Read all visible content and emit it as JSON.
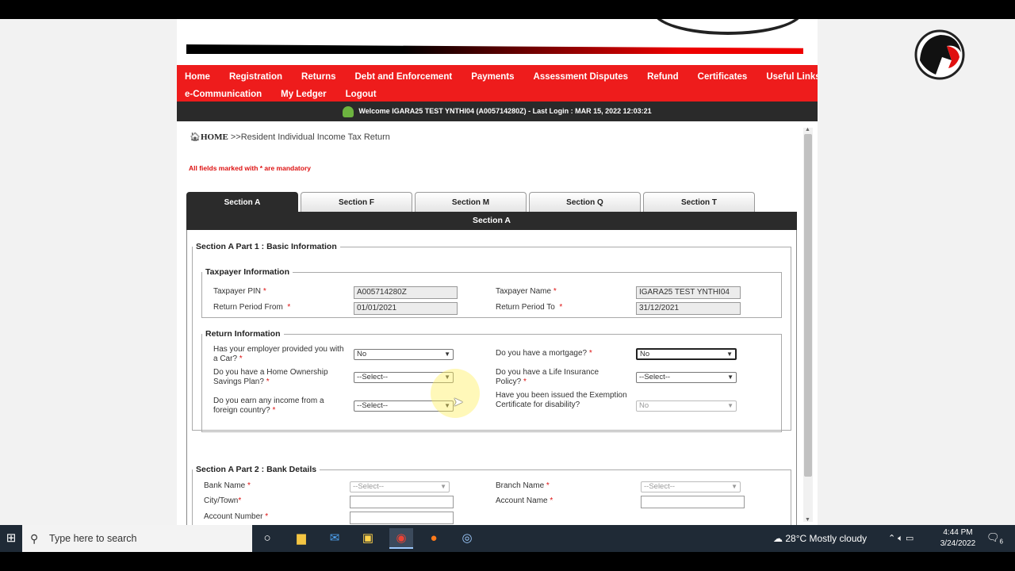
{
  "nav": {
    "row1": [
      "Home",
      "Registration",
      "Returns",
      "Debt and Enforcement",
      "Payments",
      "Assessment Disputes",
      "Refund",
      "Certificates",
      "Useful Links"
    ],
    "row2": [
      "e-Communication",
      "My Ledger",
      "Logout"
    ]
  },
  "welcome": "Welcome IGARA25 TEST YNTHI04 (A005714280Z)   - Last Login : MAR 15, 2022 12:03:21",
  "breadcrumb": {
    "home": "HOME",
    "current": ">>Resident Individual Income Tax Return"
  },
  "mandatory_note": "All fields marked with * are mandatory",
  "tabs": [
    "Section A",
    "Section F",
    "Section M",
    "Section Q",
    "Section T"
  ],
  "section_title": "Section A",
  "part1": {
    "legend": "Section A Part 1 : Basic Information",
    "taxpayer": {
      "legend": "Taxpayer Information",
      "pin_label": "Taxpayer PIN",
      "pin_value": "A005714280Z",
      "name_label": "Taxpayer Name",
      "name_value": "IGARA25 TEST YNTHI04",
      "from_label": "Return Period From",
      "from_value": "01/01/2021",
      "to_label": "Return Period To",
      "to_value": "31/12/2021"
    },
    "return_info": {
      "legend": "Return Information",
      "car_label": "Has your employer provided you with a Car?",
      "car_value": "No",
      "mortgage_label": "Do you have a mortgage?",
      "mortgage_value": "No",
      "home_label": "Do you have a Home Ownership Savings Plan?",
      "home_value": "--Select--",
      "life_label": "Do you have a Life Insurance Policy?",
      "life_value": "--Select--",
      "foreign_label": "Do you earn any income from a foreign country?",
      "foreign_value": "--Select--",
      "exemption_label": "Have you been issued the Exemption Certificate for disability?",
      "exemption_value": "No"
    }
  },
  "part2": {
    "legend": "Section A Part 2 : Bank Details",
    "bank_label": "Bank Name",
    "bank_value": "--Select--",
    "branch_label": "Branch Name",
    "branch_value": "--Select--",
    "city_label": "City/Town",
    "account_name_label": "Account Name",
    "account_number_label": "Account Number"
  },
  "required_mark": "*",
  "taskbar": {
    "search_placeholder": "Type here to search",
    "weather": "28°C  Mostly cloudy",
    "time": "4:44 PM",
    "date": "3/24/2022",
    "notif_count": "6"
  },
  "colors": {
    "nav_red": "#ee1c1c",
    "dark_bar": "#2b2b2b",
    "mandatory_red": "#dd1111"
  }
}
